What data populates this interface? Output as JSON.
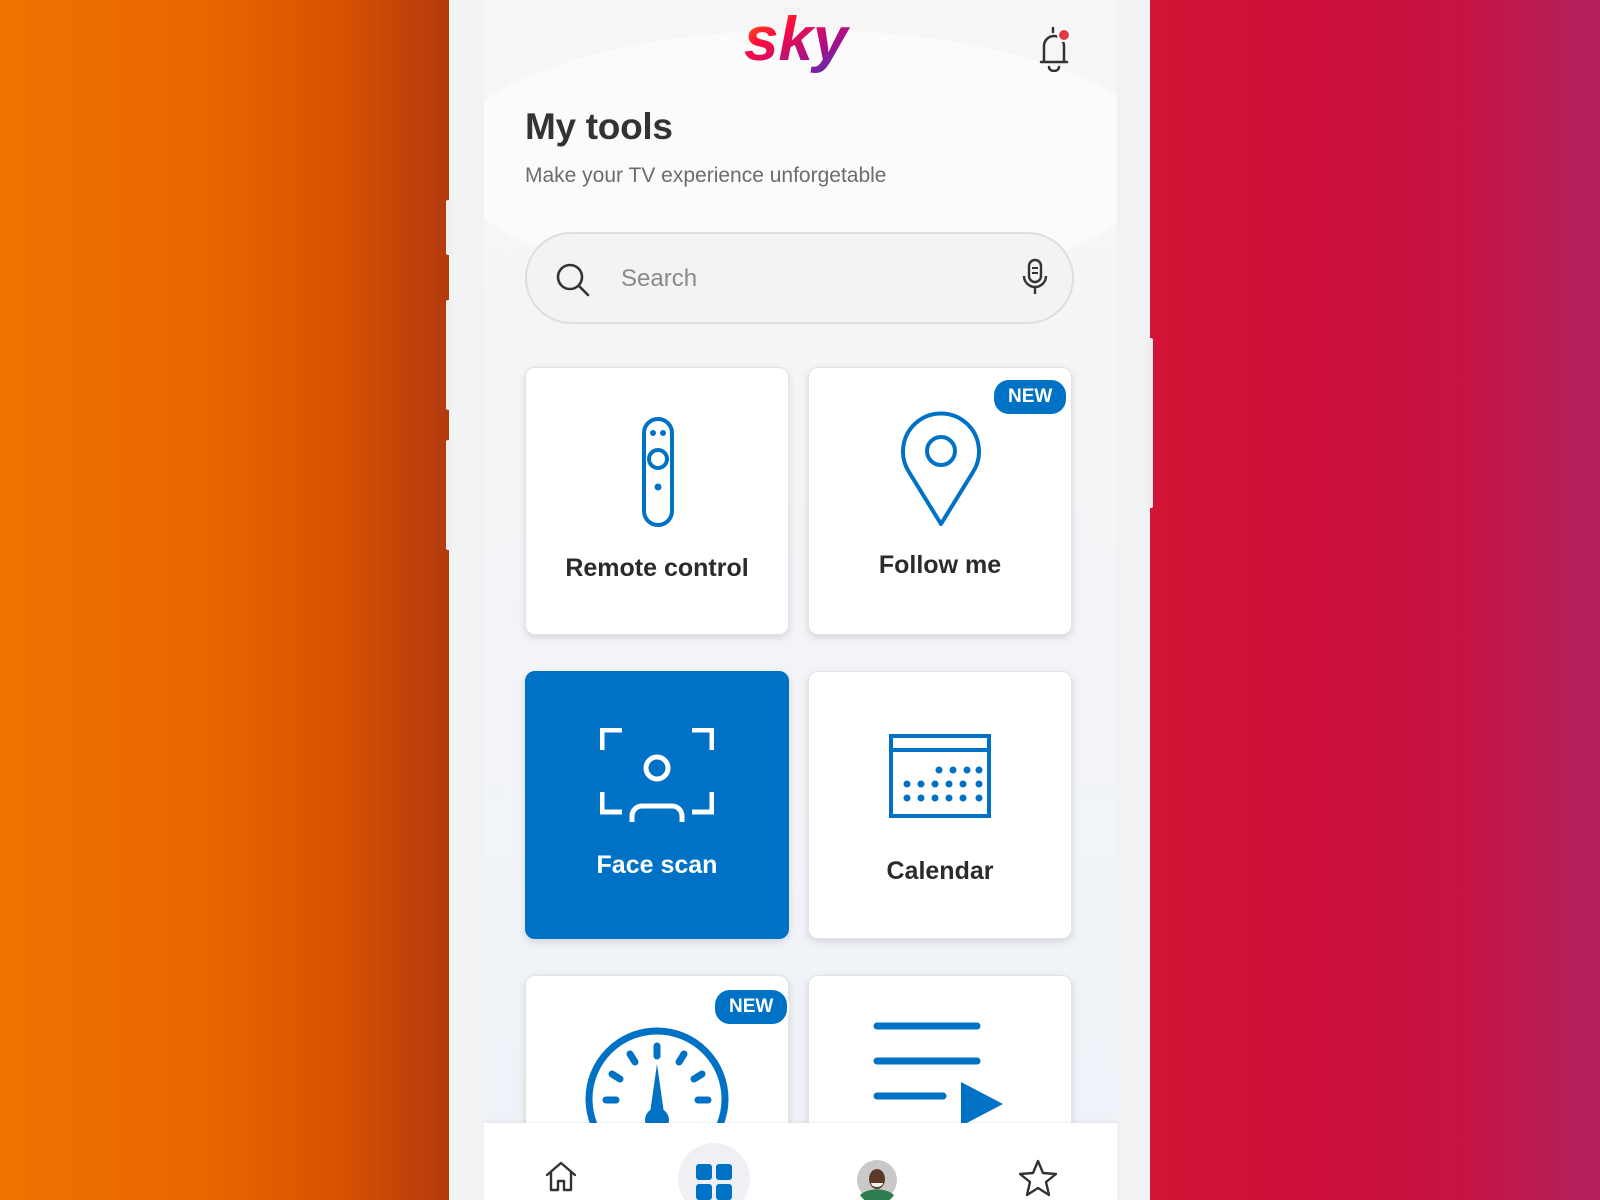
{
  "brand": {
    "name": "sky",
    "accent": "#0072c6",
    "notification_dot": "#e63946"
  },
  "header": {
    "title": "My tools",
    "subtitle": "Make your TV experience unforgetable"
  },
  "search": {
    "placeholder": "Search",
    "value": ""
  },
  "tools": [
    {
      "label": "Remote control",
      "icon": "remote-control-icon",
      "badge": "",
      "active": false
    },
    {
      "label": "Follow me",
      "icon": "location-pin-icon",
      "badge": "NEW",
      "active": false
    },
    {
      "label": "Face scan",
      "icon": "face-scan-icon",
      "badge": "",
      "active": true
    },
    {
      "label": "Calendar",
      "icon": "calendar-icon",
      "badge": "",
      "active": false
    },
    {
      "label": "",
      "icon": "speedometer-icon",
      "badge": "NEW",
      "active": false
    },
    {
      "label": "",
      "icon": "playlist-icon",
      "badge": "",
      "active": false
    }
  ],
  "bottom_nav": [
    {
      "icon": "home-icon",
      "active": false
    },
    {
      "icon": "tools-grid-icon",
      "active": true
    },
    {
      "icon": "profile-avatar",
      "active": false
    },
    {
      "icon": "star-icon",
      "active": false
    }
  ]
}
